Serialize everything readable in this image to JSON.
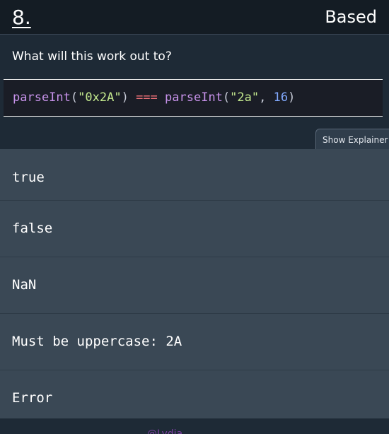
{
  "header": {
    "number": "8.",
    "title": "Based"
  },
  "question": {
    "prompt": "What will this work out to?",
    "code": {
      "fn1": "parseInt",
      "open1": "(",
      "str1": "\"0x2A\"",
      "close1": ")",
      "op": "===",
      "fn2": "parseInt",
      "open2": "(",
      "str2": "\"2a\"",
      "comma": ", ",
      "num": "16",
      "close2": ")"
    }
  },
  "explainer_button": {
    "label": "Show Explainer"
  },
  "answers": [
    {
      "label": "true"
    },
    {
      "label": "false"
    },
    {
      "label": "NaN"
    },
    {
      "label": "Must be uppercase: 2A"
    },
    {
      "label": "Error"
    }
  ],
  "footer": {
    "link_text": "@Lydia"
  }
}
